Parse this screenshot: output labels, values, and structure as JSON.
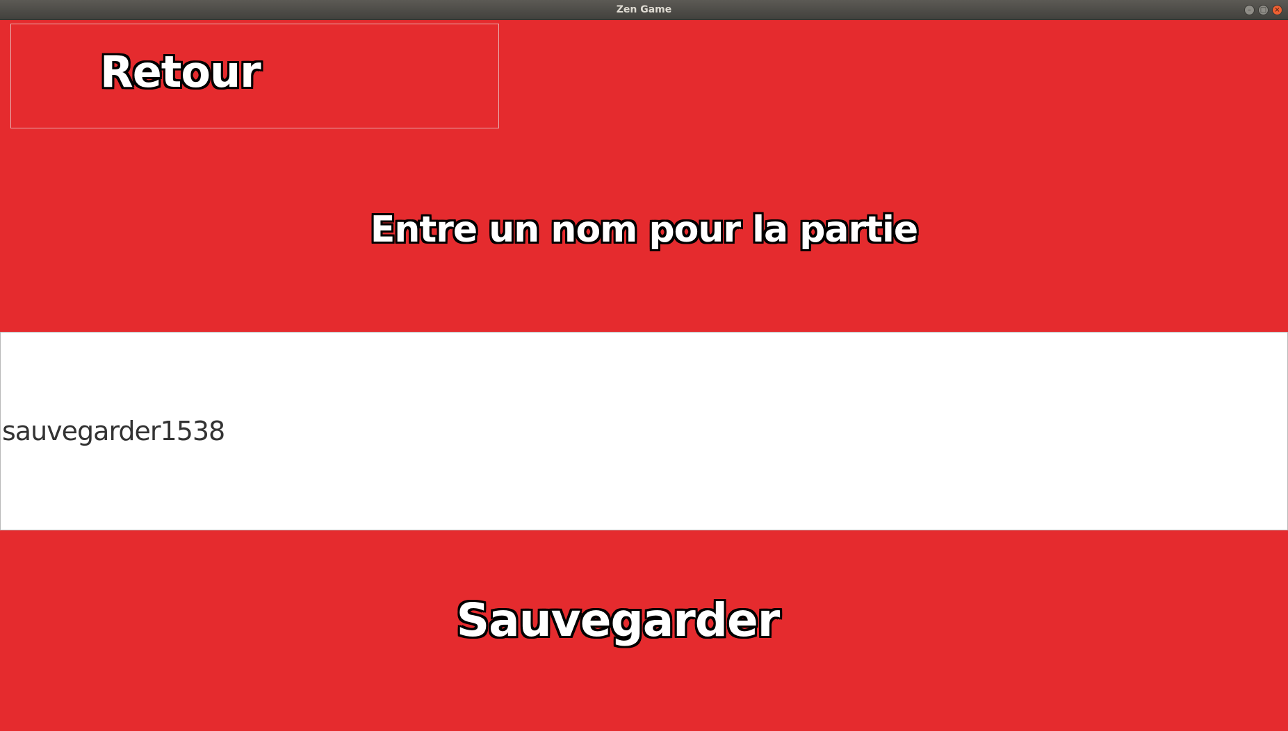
{
  "window": {
    "title": "Zen Game",
    "controls": {
      "minimize": "–",
      "maximize": "□",
      "close": "×"
    }
  },
  "screen": {
    "back_label": "Retour",
    "prompt": "Entre un nom pour la partie",
    "name_input": {
      "value": "sauvegarder1538"
    },
    "save_label": "Sauvegarder"
  },
  "colors": {
    "background": "#e52b2e",
    "input_background": "#ffffff",
    "label_fill": "#ffffff",
    "label_outline": "#000000",
    "input_text": "#333333"
  }
}
